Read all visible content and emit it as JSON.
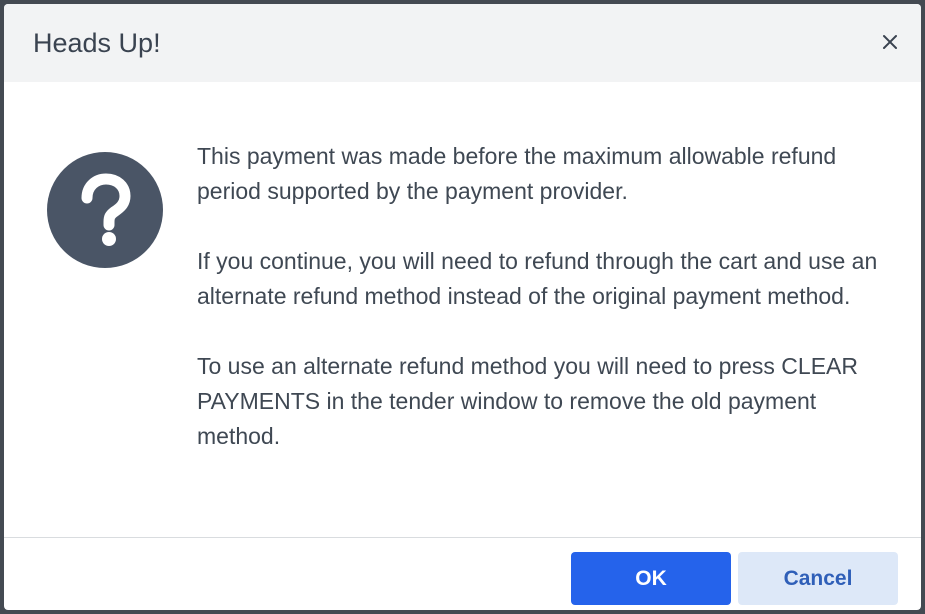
{
  "dialog": {
    "title": "Heads Up!",
    "close_icon": "close-icon",
    "status_icon": "question-circle-icon",
    "message_paragraphs": [
      "This payment was made before the maximum allowable refund period supported by the payment provider.",
      "If you continue, you will need to refund through the cart and use an alternate refund method instead of the original payment method.",
      "To use an alternate refund method you will need to press CLEAR PAYMENTS in the tender window to remove the old payment method."
    ],
    "buttons": {
      "ok_label": "OK",
      "cancel_label": "Cancel"
    }
  },
  "colors": {
    "primary": "#2563eb",
    "secondary_bg": "#dde8f8",
    "icon_bg": "#4a5566",
    "header_bg": "#f2f3f4"
  }
}
